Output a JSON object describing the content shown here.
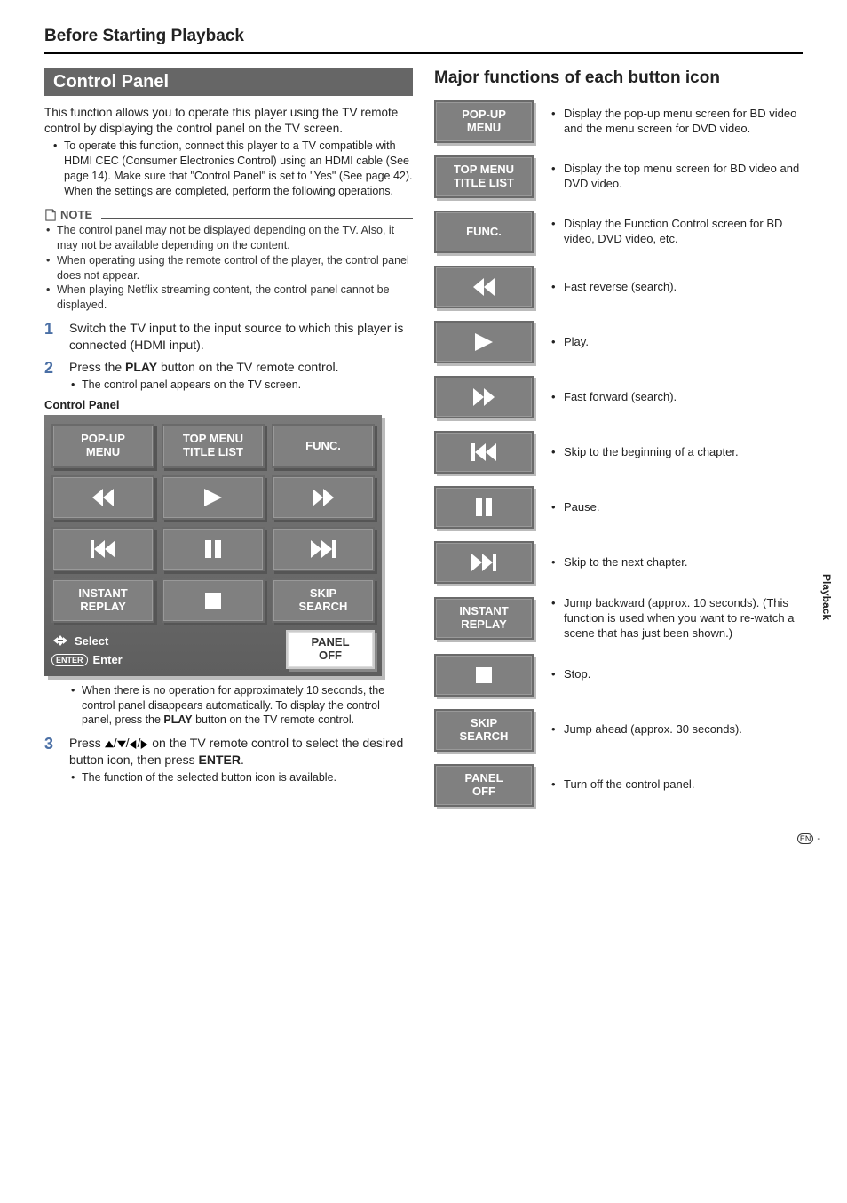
{
  "page_heading": "Before Starting Playback",
  "side_tab": "Playback",
  "footer_lang": "EN",
  "footer_dash": "-",
  "left": {
    "section_bar": "Control Panel",
    "intro": "This function allows you to operate this player using the TV remote control by displaying the control panel on the TV screen.",
    "intro_bullets": [
      "To operate this function, connect this player to a TV compatible with HDMI CEC (Consumer Electronics Control) using an HDMI cable (See page 14). Make sure that \"Control Panel\" is set to \"Yes\" (See page 42). When the settings are completed, perform the following operations."
    ],
    "note_label": "NOTE",
    "notes": [
      "The control panel may not be displayed depending on the TV. Also, it may not be available depending on the content.",
      "When operating using the remote control of the player, the control panel does not appear.",
      "When playing Netflix streaming content, the control panel cannot be displayed."
    ],
    "steps": [
      {
        "num": "1",
        "text_parts": [
          "Switch the TV input to the input source to which this player is connected (HDMI input)."
        ]
      },
      {
        "num": "2",
        "text_parts": [
          "Press the ",
          "PLAY",
          " button on the TV remote control."
        ],
        "subs": [
          "The control panel appears on the TV screen."
        ]
      }
    ],
    "cp_caption": "Control Panel",
    "cp_buttons": {
      "r1c1a": "POP-UP",
      "r1c1b": "MENU",
      "r1c2a": "TOP MENU",
      "r1c2b": "TITLE LIST",
      "r1c3": "FUNC.",
      "r4c1a": "INSTANT",
      "r4c1b": "REPLAY",
      "r4c3a": "SKIP",
      "r4c3b": "SEARCH",
      "panel_off_a": "PANEL",
      "panel_off_b": "OFF"
    },
    "cp_help": {
      "select": "Select",
      "enter_pill": "ENTER",
      "enter_label": "Enter"
    },
    "step2_after_bullets": [
      "When there is no operation for approximately 10 seconds, the control panel disappears automatically. To display the control panel, press the PLAY button on the TV remote control."
    ],
    "step3": {
      "num": "3",
      "pre": "Press ",
      "mid": " on the TV remote control to select the desired button icon, then press ",
      "post_bold": "ENTER",
      "post_end": ".",
      "subs": [
        "The function of the selected button icon is available."
      ]
    }
  },
  "right": {
    "title": "Major functions of each button icon",
    "rows": [
      {
        "label_a": "POP-UP",
        "label_b": "MENU",
        "icon": "",
        "desc": "Display the pop-up menu screen for BD video and the menu screen for DVD video."
      },
      {
        "label_a": "TOP MENU",
        "label_b": "TITLE LIST",
        "icon": "",
        "desc": "Display the top menu screen for BD video and DVD video."
      },
      {
        "label_a": "FUNC.",
        "label_b": "",
        "icon": "",
        "desc": "Display the Function Control screen for BD video, DVD video, etc."
      },
      {
        "label_a": "",
        "label_b": "",
        "icon": "rew",
        "desc": "Fast reverse (search)."
      },
      {
        "label_a": "",
        "label_b": "",
        "icon": "play",
        "desc": "Play."
      },
      {
        "label_a": "",
        "label_b": "",
        "icon": "ffwd",
        "desc": "Fast forward (search)."
      },
      {
        "label_a": "",
        "label_b": "",
        "icon": "prev",
        "desc": "Skip to the beginning of a chapter."
      },
      {
        "label_a": "",
        "label_b": "",
        "icon": "pause",
        "desc": "Pause."
      },
      {
        "label_a": "",
        "label_b": "",
        "icon": "next",
        "desc": "Skip to the next chapter."
      },
      {
        "label_a": "INSTANT",
        "label_b": "REPLAY",
        "icon": "",
        "desc": "Jump backward (approx. 10 seconds). (This function is used when you want to re-watch a scene that has just been shown.)"
      },
      {
        "label_a": "",
        "label_b": "",
        "icon": "stop",
        "desc": "Stop."
      },
      {
        "label_a": "SKIP",
        "label_b": "SEARCH",
        "icon": "",
        "desc": "Jump ahead (approx. 30 seconds)."
      },
      {
        "label_a": "PANEL",
        "label_b": "OFF",
        "icon": "",
        "desc": "Turn off the control panel."
      }
    ]
  }
}
